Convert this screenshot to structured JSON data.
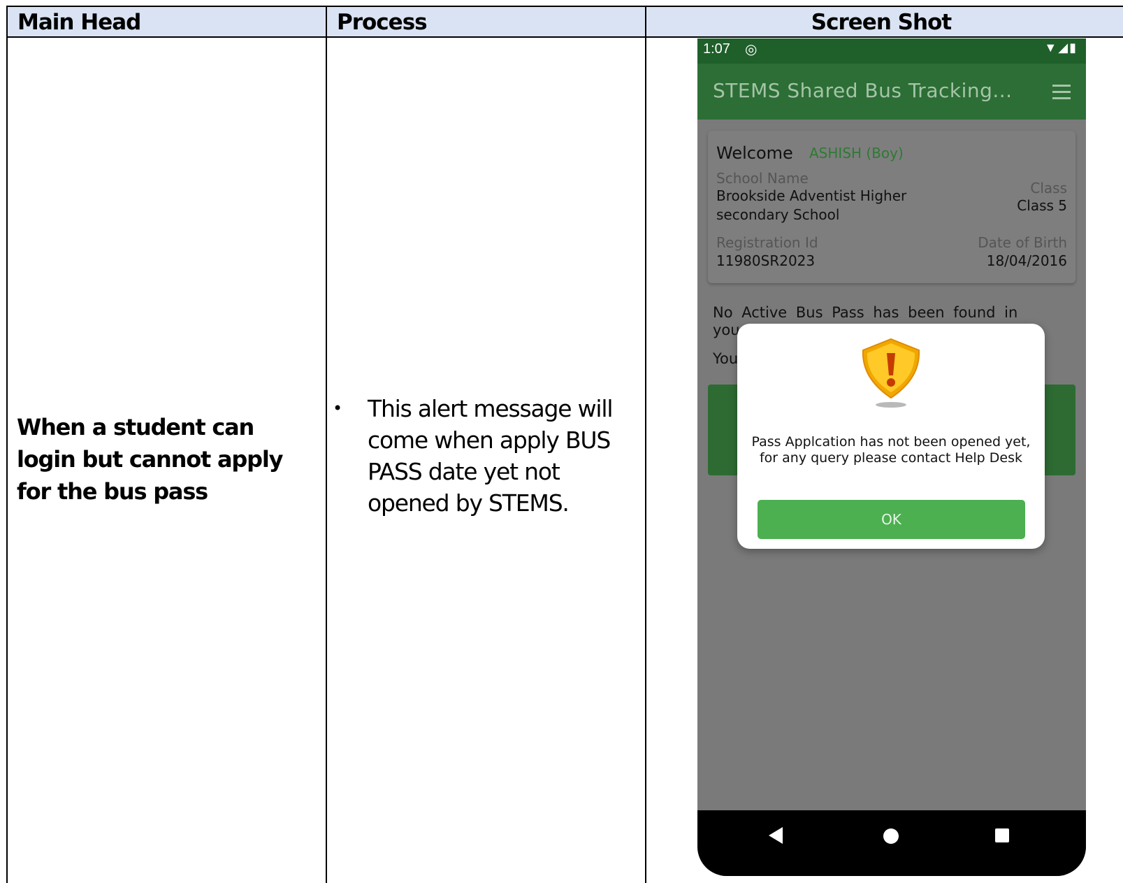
{
  "table": {
    "headers": [
      "Main Head",
      "Process",
      "Screen Shot"
    ],
    "main_head": "When a student can login but cannot apply for the bus pass",
    "process_bullet": "•",
    "process_text": "This alert message will come when apply BUS PASS date yet not opened by STEMS."
  },
  "phone": {
    "status_time": "1:07",
    "app_title": "STEMS Shared Bus Tracking...",
    "welcome_label": "Welcome",
    "student_name": "ASHISH (Boy)",
    "school_name_label": "School Name",
    "school_name_line1": "Brookside Adventist Higher",
    "school_name_line2": "secondary School",
    "class_label": "Class",
    "class_value": "Class 5",
    "registration_label": "Registration Id",
    "registration_value": "11980SR2023",
    "dob_label": "Date of Birth",
    "dob_value": "18/04/2016",
    "no_pass_text": "No Active Bus Pass has been found in",
    "cut_line1": "you",
    "cut_line2": "You",
    "dialog_message": "Pass Applcation has not been opened yet, for any query please contact Help Desk",
    "ok_label": "OK"
  },
  "colors": {
    "header_bg": "#dae3f3",
    "app_bar": "#2c6e35",
    "ok_button": "#4caf50",
    "warning_icon": "#f5b400"
  },
  "icons": [
    "status-target-icon",
    "wifi-icon",
    "signal-icon",
    "battery-icon",
    "menu-icon",
    "warning-shield-icon",
    "nav-back-icon",
    "nav-home-icon",
    "nav-recent-icon"
  ]
}
